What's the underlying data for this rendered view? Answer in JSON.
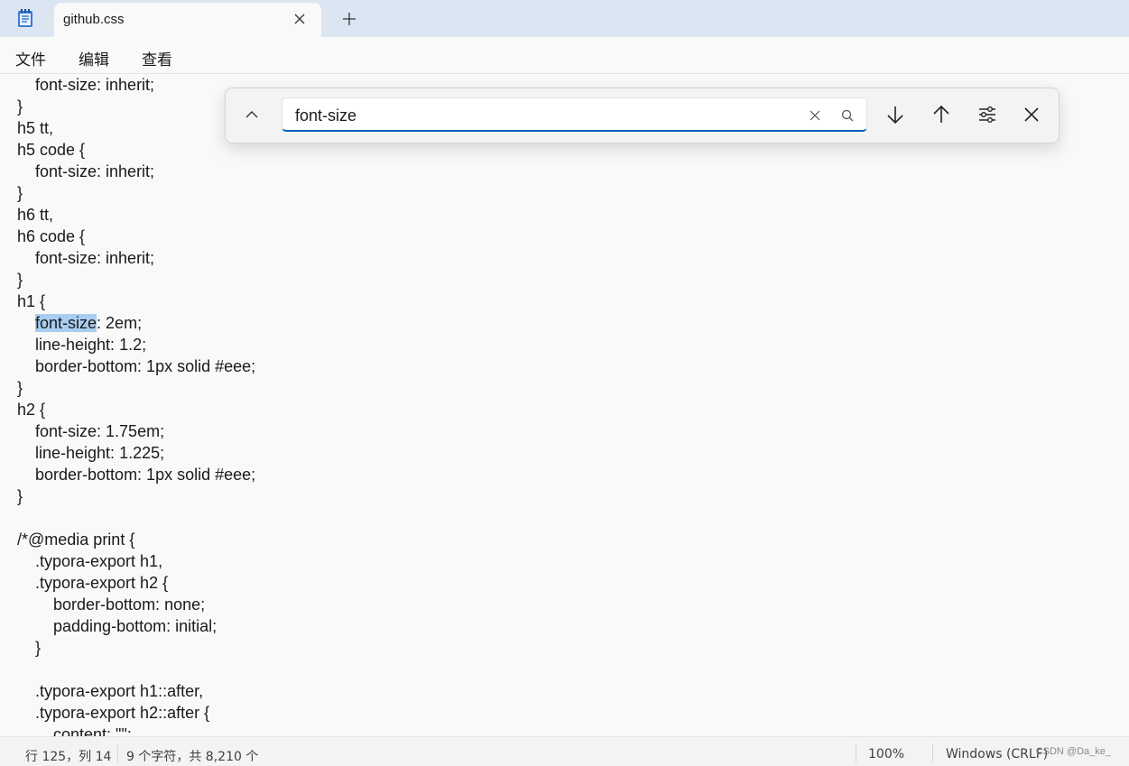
{
  "tab": {
    "title": "github.css",
    "close_icon": "close-icon",
    "new_tab_icon": "plus-icon",
    "app_icon": "notepad-icon"
  },
  "menu": {
    "items": [
      "文件",
      "编辑",
      "查看"
    ]
  },
  "find": {
    "value": "font-size",
    "collapse_icon": "chevron-up-icon",
    "clear_icon": "close-icon",
    "search_icon": "search-icon",
    "next_icon": "arrow-down-icon",
    "prev_icon": "arrow-up-icon",
    "options_icon": "sliders-icon",
    "close_icon": "close-icon"
  },
  "editor": {
    "lines": [
      "    font-size: inherit;",
      "}",
      "h5 tt,",
      "h5 code {",
      "    font-size: inherit;",
      "}",
      "h6 tt,",
      "h6 code {",
      "    font-size: inherit;",
      "}",
      "h1 {",
      "    font-size: 2em;",
      "    line-height: 1.2;",
      "    border-bottom: 1px solid #eee;",
      "}",
      "h2 {",
      "    font-size: 1.75em;",
      "    line-height: 1.225;",
      "    border-bottom: 1px solid #eee;",
      "}",
      "",
      "/*@media print {",
      "    .typora-export h1,",
      "    .typora-export h2 {",
      "        border-bottom: none;",
      "        padding-bottom: initial;",
      "    }",
      "",
      "    .typora-export h1::after,",
      "    .typora-export h2::after {",
      "        content: \"\";"
    ],
    "highlight": {
      "indent": "    ",
      "match": "font-size",
      "rest": ": 2em;"
    },
    "accent_color": "#005fb8",
    "highlight_color": "#a8cdf0"
  },
  "status": {
    "position": "行 125，列 14",
    "selection": "9 个字符，共 8,210 个",
    "zoom": "100%",
    "line_ending": "Windows (CRLF)",
    "watermark": "CSDN @Da_ke_"
  }
}
